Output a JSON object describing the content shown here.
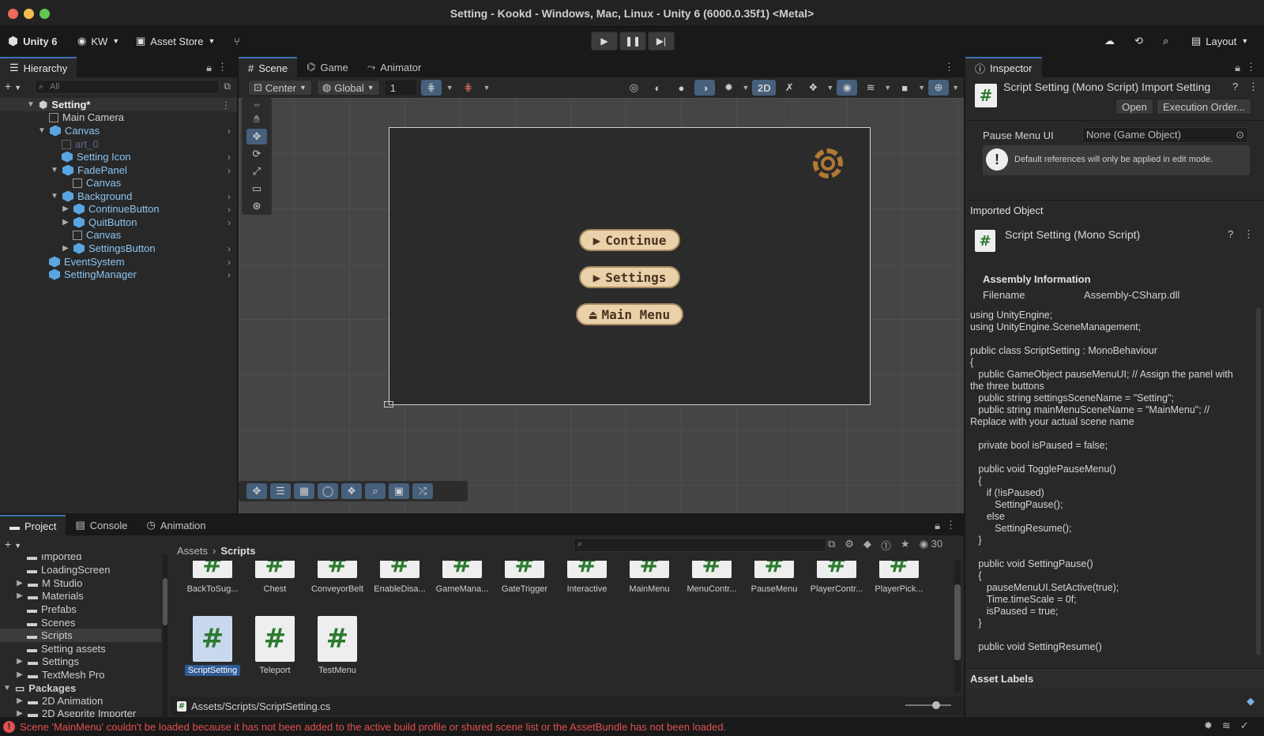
{
  "window": {
    "title": "Setting - Kookd - Windows, Mac, Linux - Unity 6 (6000.0.35f1) <Metal>"
  },
  "toolbar": {
    "unity_label": "Unity 6",
    "account": "KW",
    "asset_store": "Asset Store",
    "layout": "Layout"
  },
  "hierarchy": {
    "tab": "Hierarchy",
    "search_placeholder": "All",
    "items": [
      {
        "label": "Setting*"
      },
      {
        "label": "Main Camera"
      },
      {
        "label": "Canvas"
      },
      {
        "label": "art_0"
      },
      {
        "label": "Setting Icon"
      },
      {
        "label": "FadePanel"
      },
      {
        "label": "Canvas"
      },
      {
        "label": "Background"
      },
      {
        "label": "ContinueButton"
      },
      {
        "label": "QuitButton"
      },
      {
        "label": "Canvas"
      },
      {
        "label": "SettingsButton"
      },
      {
        "label": "EventSystem"
      },
      {
        "label": "SettingManager"
      }
    ]
  },
  "scene": {
    "tabs": [
      "Scene",
      "Game",
      "Animator"
    ],
    "pivot": "Center",
    "space": "Global",
    "snap_value": "1",
    "mode_2d": "2D",
    "buttons": [
      "Continue",
      "Settings",
      "Main Menu"
    ]
  },
  "inspector": {
    "tab": "Inspector",
    "header_title": "Script Setting (Mono Script) Import Setting",
    "open_label": "Open",
    "exec_order_label": "Execution Order...",
    "pause_menu_label": "Pause Menu UI",
    "pause_menu_value": "None (Game Object)",
    "warning": "Default references will only be applied in edit mode.",
    "imported_object": "Imported Object",
    "mono_script": "Script Setting (Mono Script)",
    "assembly_info": "Assembly Information",
    "filename_label": "Filename",
    "filename_value": "Assembly-CSharp.dll",
    "code": "using UnityEngine;\nusing UnityEngine.SceneManagement;\n\npublic class ScriptSetting : MonoBehaviour\n{\n   public GameObject pauseMenuUI; // Assign the panel with the three buttons\n   public string settingsSceneName = \"Setting\";\n   public string mainMenuSceneName = \"MainMenu\"; // Replace with your actual scene name\n\n   private bool isPaused = false;\n\n   public void TogglePauseMenu()\n   {\n      if (!isPaused)\n         SettingPause();\n      else\n         SettingResume();\n   }\n\n   public void SettingPause()\n   {\n      pauseMenuUI.SetActive(true);\n      Time.timeScale = 0f;\n      isPaused = true;\n   }\n\n   public void SettingResume()",
    "asset_labels": "Asset Labels"
  },
  "project": {
    "tabs": [
      "Project",
      "Console",
      "Animation"
    ],
    "count": "30",
    "breadcrumb_root": "Assets",
    "breadcrumb_current": "Scripts",
    "tree": [
      {
        "label": "Imported"
      },
      {
        "label": "LoadingScreen"
      },
      {
        "label": "M Studio"
      },
      {
        "label": "Materials"
      },
      {
        "label": "Prefabs"
      },
      {
        "label": "Scenes"
      },
      {
        "label": "Scripts"
      },
      {
        "label": "Setting assets"
      },
      {
        "label": "Settings"
      },
      {
        "label": "TextMesh Pro"
      },
      {
        "label": "Packages"
      },
      {
        "label": "2D Animation"
      },
      {
        "label": "2D Aseprite Importer"
      }
    ],
    "assets_row1": [
      "BackToSug...",
      "Chest",
      "ConveyorBelt",
      "EnableDisa...",
      "GameMana...",
      "GateTrigger",
      "Interactive",
      "MainMenu",
      "MenuContr...",
      "PauseMenu",
      "PlayerContr...",
      "PlayerPick..."
    ],
    "assets_row2": [
      "ScriptSetting",
      "Teleport",
      "TestMenu"
    ],
    "path": "Assets/Scripts/ScriptSetting.cs"
  },
  "status": {
    "message": "Scene 'MainMenu' couldn't be loaded because it has not been added to the active build profile or shared scene list or the AssetBundle has not been loaded."
  },
  "colors": {
    "accent": "#3a72b0",
    "error": "#e05050",
    "button_fill": "#e9d2aa",
    "button_text": "#4b3321",
    "cube": "#5aa5e0"
  }
}
